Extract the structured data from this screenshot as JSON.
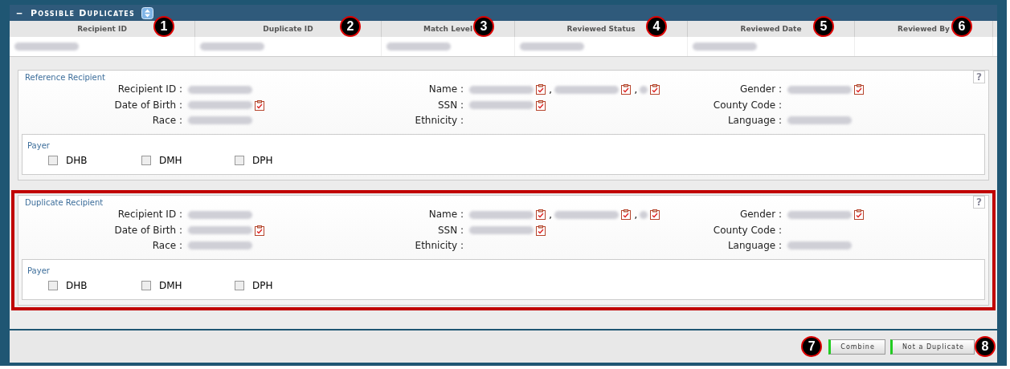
{
  "panel": {
    "collapse_glyph": "−",
    "title": "Possible Duplicates"
  },
  "table": {
    "columns": [
      {
        "label": "Recipient ID",
        "callout": "1"
      },
      {
        "label": "Duplicate ID",
        "callout": "2"
      },
      {
        "label": "Match Level",
        "callout": "3"
      },
      {
        "label": "Reviewed Status",
        "callout": "4"
      },
      {
        "label": "Reviewed Date",
        "callout": "5"
      },
      {
        "label": "Reviewed By",
        "callout": "6"
      }
    ],
    "rows": [
      {
        "cells": [
          {
            "redacted": true
          },
          {
            "redacted": true
          },
          {
            "redacted": true
          },
          {
            "redacted": true
          },
          {
            "redacted": true
          },
          {
            "redacted": false
          }
        ]
      }
    ]
  },
  "sections": [
    {
      "legend": "Reference Recipient",
      "highlighted": false,
      "help": "?",
      "fields": [
        {
          "label": "Recipient ID :",
          "parts": [
            {
              "verify": false
            }
          ]
        },
        {
          "label": "Name :",
          "parts": [
            {
              "verify": true
            },
            {
              "separator": ",",
              "verify": true
            },
            {
              "separator": ",",
              "verify": true,
              "short": true
            }
          ]
        },
        {
          "label": "Gender :",
          "parts": [
            {
              "verify": true
            }
          ]
        },
        {
          "label": "Date of Birth :",
          "parts": [
            {
              "verify": true
            }
          ]
        },
        {
          "label": "SSN :",
          "parts": [
            {
              "verify": true
            }
          ]
        },
        {
          "label": "County Code :"
        },
        {
          "label": "Race :",
          "parts": [
            {
              "verify": false
            }
          ]
        },
        {
          "label": "Ethnicity :"
        },
        {
          "label": "Language :",
          "parts": [
            {
              "verify": false
            }
          ]
        }
      ],
      "payer": {
        "legend": "Payer",
        "options": [
          {
            "label": "DHB",
            "checked": false
          },
          {
            "label": "DMH",
            "checked": false
          },
          {
            "label": "DPH",
            "checked": false
          }
        ]
      }
    },
    {
      "legend": "Duplicate Recipient",
      "highlighted": true,
      "help": "?",
      "fields": [
        {
          "label": "Recipient ID :",
          "parts": [
            {
              "verify": false
            }
          ]
        },
        {
          "label": "Name :",
          "parts": [
            {
              "verify": true
            },
            {
              "separator": ",",
              "verify": true
            },
            {
              "separator": ",",
              "verify": true,
              "short": true
            }
          ]
        },
        {
          "label": "Gender :",
          "parts": [
            {
              "verify": true
            }
          ]
        },
        {
          "label": "Date of Birth :",
          "parts": [
            {
              "verify": true
            }
          ]
        },
        {
          "label": "SSN :",
          "parts": [
            {
              "verify": true
            }
          ]
        },
        {
          "label": "County Code :"
        },
        {
          "label": "Race :",
          "parts": [
            {
              "verify": false
            }
          ]
        },
        {
          "label": "Ethnicity :"
        },
        {
          "label": "Language :",
          "parts": [
            {
              "verify": false
            }
          ]
        }
      ],
      "payer": {
        "legend": "Payer",
        "options": [
          {
            "label": "DHB",
            "checked": false
          },
          {
            "label": "DMH",
            "checked": false
          },
          {
            "label": "DPH",
            "checked": false
          }
        ]
      }
    }
  ],
  "buttons": [
    {
      "label": "Combine",
      "callout": "7"
    },
    {
      "label": "Not a Duplicate",
      "callout": "8"
    }
  ]
}
